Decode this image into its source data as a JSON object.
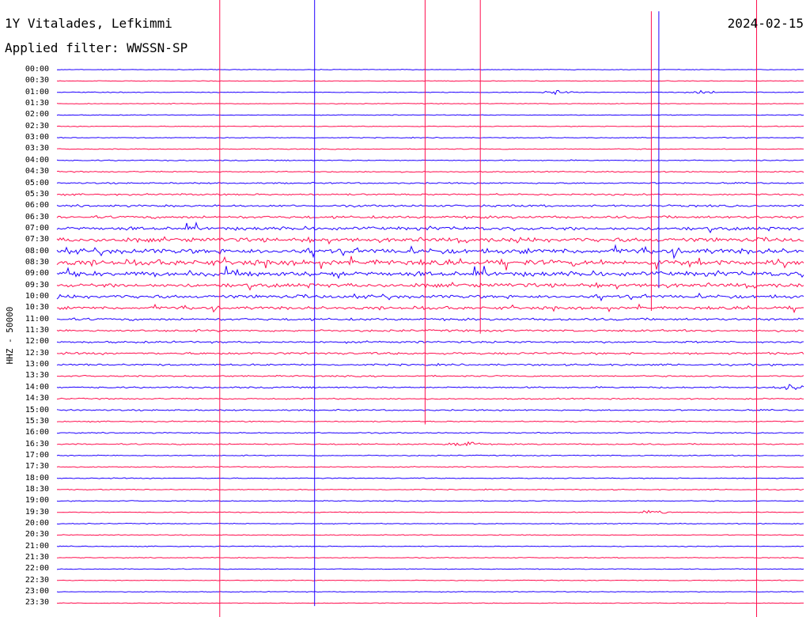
{
  "header": {
    "station": "1Y Vitalades, Lefkimmi",
    "date": "2024-02-15",
    "filter_label": "Applied filter:",
    "filter_value": "WWSSN-SP"
  },
  "channel_label": "HHZ - 50000",
  "colors": {
    "trace_a": "#1f00ff",
    "trace_b": "#ff0f4f",
    "background": "#ffffff",
    "text": "#000000"
  },
  "chart_data": {
    "type": "line",
    "chart_kind": "helicorder (seismic drum plot)",
    "rows": [
      {
        "time": "00:00",
        "color": "trace_a",
        "amplitude": 0.25
      },
      {
        "time": "00:30",
        "color": "trace_b",
        "amplitude": 0.25
      },
      {
        "time": "01:00",
        "color": "trace_a",
        "amplitude": 0.3
      },
      {
        "time": "01:30",
        "color": "trace_b",
        "amplitude": 0.28
      },
      {
        "time": "02:00",
        "color": "trace_a",
        "amplitude": 0.28
      },
      {
        "time": "02:30",
        "color": "trace_b",
        "amplitude": 0.3
      },
      {
        "time": "03:00",
        "color": "trace_a",
        "amplitude": 0.32
      },
      {
        "time": "03:30",
        "color": "trace_b",
        "amplitude": 0.35
      },
      {
        "time": "04:00",
        "color": "trace_a",
        "amplitude": 0.4
      },
      {
        "time": "04:30",
        "color": "trace_b",
        "amplitude": 0.45
      },
      {
        "time": "05:00",
        "color": "trace_a",
        "amplitude": 0.55
      },
      {
        "time": "05:30",
        "color": "trace_b",
        "amplitude": 0.65
      },
      {
        "time": "06:00",
        "color": "trace_a",
        "amplitude": 0.8
      },
      {
        "time": "06:30",
        "color": "trace_b",
        "amplitude": 1.0
      },
      {
        "time": "07:00",
        "color": "trace_a",
        "amplitude": 1.3
      },
      {
        "time": "07:30",
        "color": "trace_b",
        "amplitude": 1.6
      },
      {
        "time": "08:00",
        "color": "trace_a",
        "amplitude": 1.9
      },
      {
        "time": "08:30",
        "color": "trace_b",
        "amplitude": 2.0
      },
      {
        "time": "09:00",
        "color": "trace_a",
        "amplitude": 1.8
      },
      {
        "time": "09:30",
        "color": "trace_b",
        "amplitude": 1.5
      },
      {
        "time": "10:00",
        "color": "trace_a",
        "amplitude": 1.3
      },
      {
        "time": "10:30",
        "color": "trace_b",
        "amplitude": 1.1
      },
      {
        "time": "11:00",
        "color": "trace_a",
        "amplitude": 0.9
      },
      {
        "time": "11:30",
        "color": "trace_b",
        "amplitude": 0.8
      },
      {
        "time": "12:00",
        "color": "trace_a",
        "amplitude": 0.75
      },
      {
        "time": "12:30",
        "color": "trace_b",
        "amplitude": 0.85
      },
      {
        "time": "13:00",
        "color": "trace_a",
        "amplitude": 0.7
      },
      {
        "time": "13:30",
        "color": "trace_b",
        "amplitude": 0.55
      },
      {
        "time": "14:00",
        "color": "trace_a",
        "amplitude": 0.6
      },
      {
        "time": "14:30",
        "color": "trace_b",
        "amplitude": 0.5
      },
      {
        "time": "15:00",
        "color": "trace_a",
        "amplitude": 0.55
      },
      {
        "time": "15:30",
        "color": "trace_b",
        "amplitude": 0.45
      },
      {
        "time": "16:00",
        "color": "trace_a",
        "amplitude": 0.42
      },
      {
        "time": "16:30",
        "color": "trace_b",
        "amplitude": 0.5
      },
      {
        "time": "17:00",
        "color": "trace_a",
        "amplitude": 0.4
      },
      {
        "time": "17:30",
        "color": "trace_b",
        "amplitude": 0.38
      },
      {
        "time": "18:00",
        "color": "trace_a",
        "amplitude": 0.38
      },
      {
        "time": "18:30",
        "color": "trace_b",
        "amplitude": 0.36
      },
      {
        "time": "19:00",
        "color": "trace_a",
        "amplitude": 0.35
      },
      {
        "time": "19:30",
        "color": "trace_b",
        "amplitude": 0.35
      },
      {
        "time": "20:00",
        "color": "trace_a",
        "amplitude": 0.33
      },
      {
        "time": "20:30",
        "color": "trace_b",
        "amplitude": 0.32
      },
      {
        "time": "21:00",
        "color": "trace_a",
        "amplitude": 0.32
      },
      {
        "time": "21:30",
        "color": "trace_b",
        "amplitude": 0.3
      },
      {
        "time": "22:00",
        "color": "trace_a",
        "amplitude": 0.3
      },
      {
        "time": "22:30",
        "color": "trace_b",
        "amplitude": 0.3
      },
      {
        "time": "23:00",
        "color": "trace_a",
        "amplitude": 0.28
      },
      {
        "time": "23:30",
        "color": "trace_b",
        "amplitude": 0.28
      }
    ],
    "spike_events": [
      {
        "time_fraction": 0.218,
        "color": "trace_b",
        "rows": [
          0,
          47
        ]
      },
      {
        "time_fraction": 0.345,
        "color": "trace_a",
        "rows": [
          0,
          46
        ]
      },
      {
        "time_fraction": 0.493,
        "color": "trace_b",
        "rows": [
          0,
          30
        ]
      },
      {
        "time_fraction": 0.567,
        "color": "trace_b",
        "rows": [
          0,
          22
        ]
      },
      {
        "time_fraction": 0.796,
        "color": "trace_b",
        "rows": [
          1,
          20
        ]
      },
      {
        "time_fraction": 0.806,
        "color": "trace_a",
        "rows": [
          1,
          18
        ]
      },
      {
        "time_fraction": 0.937,
        "color": "trace_b",
        "rows": [
          0,
          47
        ]
      }
    ],
    "local_events": [
      {
        "row": 2,
        "time_fraction": 0.67,
        "color": "trace_a",
        "amplitude": 1.6
      },
      {
        "row": 2,
        "time_fraction": 0.86,
        "color": "trace_a",
        "amplitude": 2.0
      },
      {
        "row": 33,
        "time_fraction": 0.545,
        "color": "trace_b",
        "amplitude": 2.2
      },
      {
        "row": 39,
        "time_fraction": 0.804,
        "color": "trace_b",
        "amplitude": 1.3
      },
      {
        "row": 28,
        "time_fraction": 0.985,
        "color": "trace_a",
        "amplitude": 1.5
      }
    ]
  }
}
